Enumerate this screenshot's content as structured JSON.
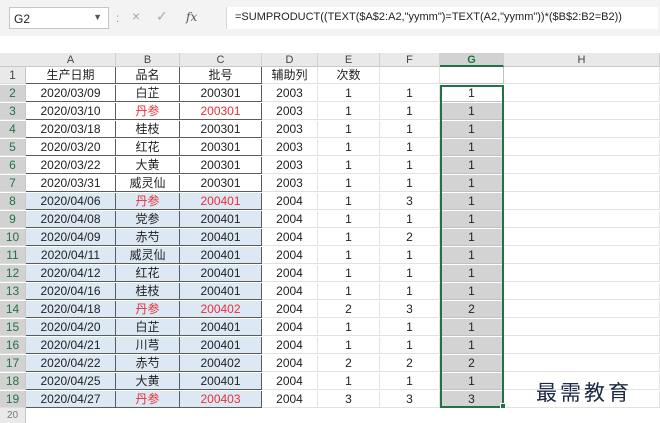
{
  "formula_bar": {
    "name_box": "G2",
    "name_box_dropdown_icon": "chevron-down-icon",
    "separator": ":",
    "cancel_glyph": "×",
    "confirm_glyph": "✓",
    "function_glyph": "fx",
    "formula": "=SUMPRODUCT((TEXT($A$2:A2,\"yymm\")=TEXT(A2,\"yymm\"))*($B$2:B2=B2))"
  },
  "columns": [
    "A",
    "B",
    "C",
    "D",
    "E",
    "F",
    "G",
    "H"
  ],
  "selected_column": "G",
  "header_row": [
    "生产日期",
    "品名",
    "批号",
    "辅助列",
    "次数",
    "",
    "",
    ""
  ],
  "rows": [
    {
      "n": "2",
      "date": "2020/03/09",
      "name": "白芷",
      "batch": "200301",
      "aux": "2003",
      "count": "1",
      "f": "1",
      "g": "1",
      "hl": false,
      "red": false
    },
    {
      "n": "3",
      "date": "2020/03/10",
      "name": "丹参",
      "batch": "200301",
      "aux": "2003",
      "count": "1",
      "f": "1",
      "g": "1",
      "hl": false,
      "red": true
    },
    {
      "n": "4",
      "date": "2020/03/18",
      "name": "桂枝",
      "batch": "200301",
      "aux": "2003",
      "count": "1",
      "f": "1",
      "g": "1",
      "hl": false,
      "red": false
    },
    {
      "n": "5",
      "date": "2020/03/20",
      "name": "红花",
      "batch": "200301",
      "aux": "2003",
      "count": "1",
      "f": "1",
      "g": "1",
      "hl": false,
      "red": false
    },
    {
      "n": "6",
      "date": "2020/03/22",
      "name": "大黄",
      "batch": "200301",
      "aux": "2003",
      "count": "1",
      "f": "1",
      "g": "1",
      "hl": false,
      "red": false
    },
    {
      "n": "7",
      "date": "2020/03/31",
      "name": "威灵仙",
      "batch": "200301",
      "aux": "2003",
      "count": "1",
      "f": "1",
      "g": "1",
      "hl": false,
      "red": false
    },
    {
      "n": "8",
      "date": "2020/04/06",
      "name": "丹参",
      "batch": "200401",
      "aux": "2004",
      "count": "1",
      "f": "3",
      "g": "1",
      "hl": true,
      "red": true
    },
    {
      "n": "9",
      "date": "2020/04/08",
      "name": "党参",
      "batch": "200401",
      "aux": "2004",
      "count": "1",
      "f": "1",
      "g": "1",
      "hl": true,
      "red": false
    },
    {
      "n": "10",
      "date": "2020/04/09",
      "name": "赤芍",
      "batch": "200401",
      "aux": "2004",
      "count": "1",
      "f": "2",
      "g": "1",
      "hl": true,
      "red": false
    },
    {
      "n": "11",
      "date": "2020/04/11",
      "name": "威灵仙",
      "batch": "200401",
      "aux": "2004",
      "count": "1",
      "f": "1",
      "g": "1",
      "hl": true,
      "red": false
    },
    {
      "n": "12",
      "date": "2020/04/12",
      "name": "红花",
      "batch": "200401",
      "aux": "2004",
      "count": "1",
      "f": "1",
      "g": "1",
      "hl": true,
      "red": false
    },
    {
      "n": "13",
      "date": "2020/04/16",
      "name": "桂枝",
      "batch": "200401",
      "aux": "2004",
      "count": "1",
      "f": "1",
      "g": "1",
      "hl": true,
      "red": false
    },
    {
      "n": "14",
      "date": "2020/04/18",
      "name": "丹参",
      "batch": "200402",
      "aux": "2004",
      "count": "2",
      "f": "3",
      "g": "2",
      "hl": true,
      "red": true
    },
    {
      "n": "15",
      "date": "2020/04/20",
      "name": "白芷",
      "batch": "200401",
      "aux": "2004",
      "count": "1",
      "f": "1",
      "g": "1",
      "hl": true,
      "red": false
    },
    {
      "n": "16",
      "date": "2020/04/21",
      "name": "川芎",
      "batch": "200401",
      "aux": "2004",
      "count": "1",
      "f": "1",
      "g": "1",
      "hl": true,
      "red": false
    },
    {
      "n": "17",
      "date": "2020/04/22",
      "name": "赤芍",
      "batch": "200402",
      "aux": "2004",
      "count": "2",
      "f": "2",
      "g": "2",
      "hl": true,
      "red": false
    },
    {
      "n": "18",
      "date": "2020/04/25",
      "name": "大黄",
      "batch": "200401",
      "aux": "2004",
      "count": "1",
      "f": "1",
      "g": "1",
      "hl": true,
      "red": false
    },
    {
      "n": "19",
      "date": "2020/04/27",
      "name": "丹参",
      "batch": "200403",
      "aux": "2004",
      "count": "3",
      "f": "3",
      "g": "3",
      "hl": true,
      "red": true
    }
  ],
  "watermark": "最需教育",
  "colors": {
    "accent": "#217346",
    "highlight_fill": "#dce8f4",
    "red_text": "#e8303a",
    "selection_fill": "#d3d3d3"
  }
}
